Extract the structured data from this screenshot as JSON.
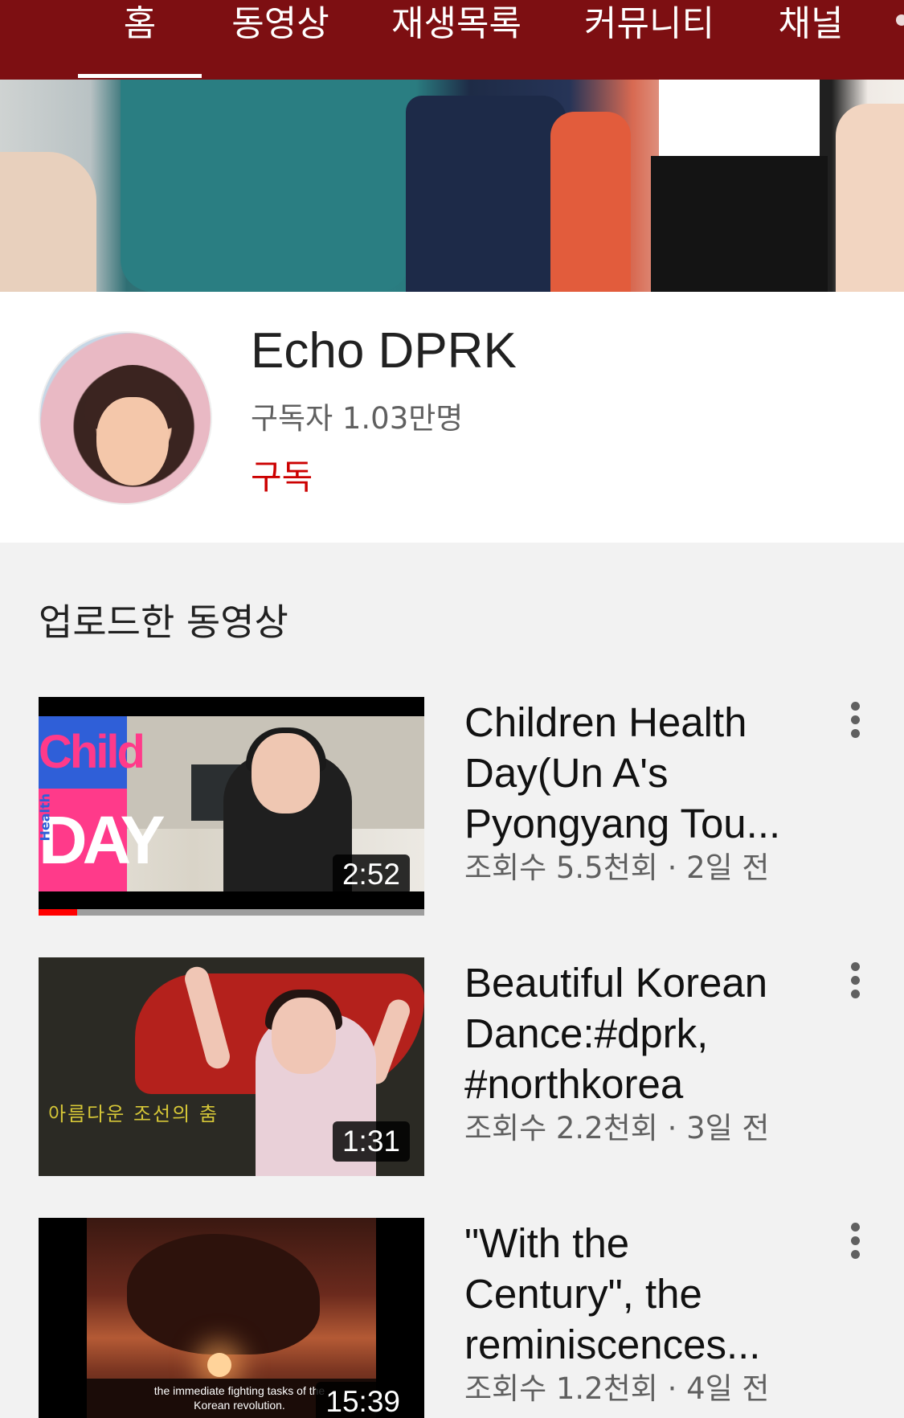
{
  "tabs": [
    {
      "label": "홈",
      "active": true
    },
    {
      "label": "동영상",
      "active": false
    },
    {
      "label": "재생목록",
      "active": false
    },
    {
      "label": "커뮤니티",
      "active": false
    },
    {
      "label": "채널",
      "active": false
    }
  ],
  "channel": {
    "name": "Echo DPRK",
    "subscribers": "구독자 1.03만명",
    "subscribe_label": "구독"
  },
  "section": {
    "title": "업로드한 동영상"
  },
  "videos": [
    {
      "title": "Children Health Day(Un A's Pyongyang Tou...",
      "meta": "조회수 5.5천회 · 2일 전",
      "duration": "2:52",
      "thumb_text_top": "Child",
      "thumb_text_bottom": "DAY",
      "thumb_text_side": "Health",
      "watched_fraction": 0.1
    },
    {
      "title": "Beautiful Korean Dance:#dprk, #northkorea",
      "meta": "조회수 2.2천회 · 3일 전",
      "duration": "1:31",
      "thumb_caption": "아름다운 조선의 춤"
    },
    {
      "title": "\"With the Century\", the reminiscences...",
      "meta": "조회수 1.2천회 · 4일 전",
      "duration": "15:39",
      "thumb_subtitle": "the immediate fighting tasks of the Korean revolution."
    }
  ],
  "colors": {
    "tabbar_bg": "#7d0f12",
    "subscribe_red": "#cc0000",
    "progress_red": "#ff0000"
  },
  "icons": {
    "overflow": "more-vert-icon"
  }
}
